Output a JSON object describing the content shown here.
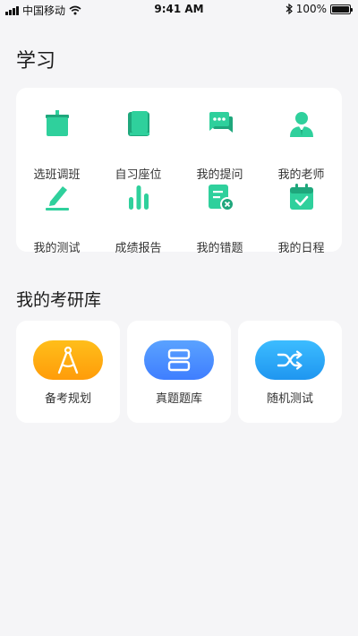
{
  "status_bar": {
    "carrier": "中国移动",
    "time": "9:41 AM",
    "battery": "100%"
  },
  "study": {
    "title": "学习",
    "items": [
      {
        "label": "选班调班",
        "icon": "signboard-icon"
      },
      {
        "label": "自习座位",
        "icon": "book-icon"
      },
      {
        "label": "我的提问",
        "icon": "chat-bubble-icon"
      },
      {
        "label": "我的老师",
        "icon": "teacher-icon"
      },
      {
        "label": "我的测试",
        "icon": "pencil-icon"
      },
      {
        "label": "成绩报告",
        "icon": "bar-chart-icon"
      },
      {
        "label": "我的错题",
        "icon": "wrong-note-icon"
      },
      {
        "label": "我的日程",
        "icon": "calendar-check-icon"
      }
    ]
  },
  "bank": {
    "title": "我的考研库",
    "items": [
      {
        "label": "备考规划",
        "icon": "compass-icon",
        "color": "#ffa80f"
      },
      {
        "label": "真题题库",
        "icon": "stack-icon",
        "color": "#4a8dff"
      },
      {
        "label": "随机测试",
        "icon": "shuffle-icon",
        "color": "#2ba8f5"
      }
    ]
  },
  "colors": {
    "accent": "#2fd09c",
    "background": "#f5f5f7"
  }
}
